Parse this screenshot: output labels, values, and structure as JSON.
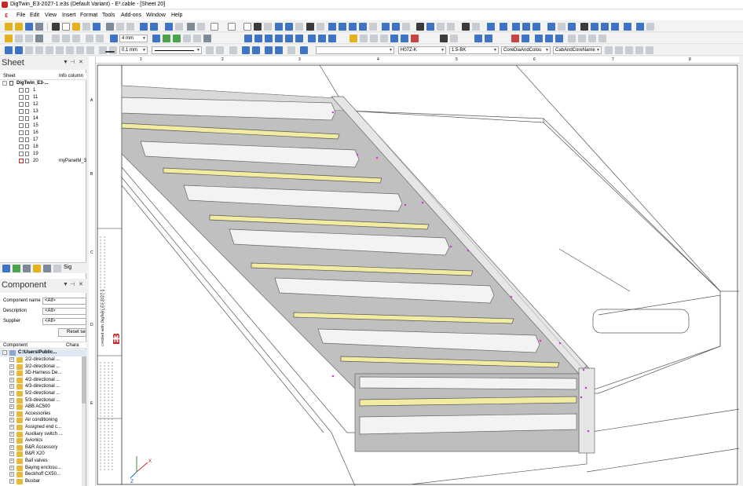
{
  "window": {
    "title": "DigTwin_E3-2027-1.e3s (Default Variant) - E³.cable - [Sheet 20]"
  },
  "menu": [
    "File",
    "Edit",
    "View",
    "Insert",
    "Format",
    "Tools",
    "Add-ons",
    "Window",
    "Help"
  ],
  "toolbar": {
    "line_width": "4 mm",
    "pen_width": "0.1 mm",
    "wire_type": "H07Z-K",
    "wire_spec": "1.5-BK",
    "display_mode": "CoreDiaAndColou",
    "label_mode": "CabAndCoreName"
  },
  "sheet_panel": {
    "title": "Sheet",
    "col_sheet": "Sheet",
    "col_info": "Info column",
    "root": "DigTwin_E3-...",
    "items": [
      "1",
      "11",
      "12",
      "13",
      "14",
      "15",
      "16",
      "17",
      "18",
      "19",
      "20"
    ],
    "active_info": "myPanelM_3",
    "tab_label": "Sig"
  },
  "component_panel": {
    "title": "Component",
    "fields": [
      {
        "label": "Component name",
        "value": "<All>"
      },
      {
        "label": "Description",
        "value": "<All>"
      },
      {
        "label": "Supplier",
        "value": "<All>"
      }
    ],
    "reset_label": "Reset sea",
    "col_component": "Component",
    "col_char": "Chara",
    "root": "C:\\Users\\Public...",
    "items": [
      "2/2-directional ...",
      "3/2-directional ...",
      "3D-Harness De...",
      "4/2-directional ...",
      "4/3-directional ...",
      "5/2-directional ...",
      "5/3-directional ...",
      "ABB AC500",
      "Accessories",
      "Air conditioning",
      "Assigned end c...",
      "Auxiliary switch ...",
      "Avionics",
      "B&R Accessory",
      "B&R X20",
      "Ball valves",
      "Baying enclosu...",
      "Beckhoff CX50...",
      "Busbar"
    ]
  },
  "rulers": {
    "top": [
      "1",
      "2",
      "3",
      "4",
      "5",
      "6",
      "7",
      "8"
    ],
    "left": [
      "A",
      "B",
      "C",
      "D",
      "E"
    ]
  },
  "drawing": {
    "axis_x": "X",
    "axis_z": "Z",
    "frame_text": "created with DigTwin_E3-2027-1",
    "brand": "E3"
  }
}
